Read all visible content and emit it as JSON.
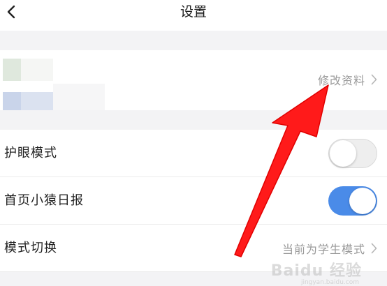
{
  "header": {
    "title": "设置",
    "back_icon": "chevron-left-icon"
  },
  "profile": {
    "edit_label": "修改资料",
    "chevron_icon": "chevron-right-icon"
  },
  "settings": {
    "eye_care": {
      "label": "护眼模式",
      "enabled": false
    },
    "homepage_daily": {
      "label": "首页小猿日报",
      "enabled": true
    },
    "mode_switch": {
      "label": "模式切换",
      "value": "当前为学生模式",
      "chevron_icon": "chevron-right-icon"
    }
  },
  "annotation": {
    "icon": "red-arrow-icon",
    "color": "#ff1a1a"
  },
  "watermark": {
    "text": "Baidu 经验",
    "sub": "jingyan.baidu.com"
  },
  "colors": {
    "toggle_on": "#4a8be8",
    "toggle_off": "#eeeeee",
    "section_gap": "#f3f3f5",
    "secondary_text": "#9a9a9a"
  }
}
